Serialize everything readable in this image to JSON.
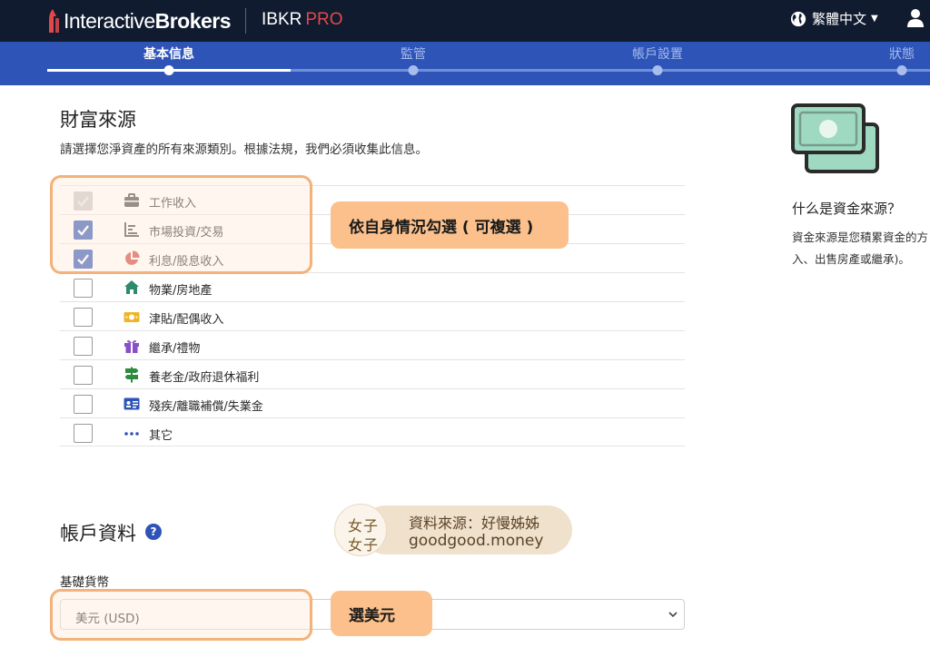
{
  "header": {
    "brand_prefix": "Interactive",
    "brand_suffix": "Brokers",
    "product": "IBKR",
    "product_tier": "PRO",
    "language": "繁體中文",
    "icons": [
      "ib-logo-icon",
      "globe-icon",
      "caret-down-icon",
      "user-icon"
    ]
  },
  "steps": [
    {
      "label": "基本信息",
      "active": true
    },
    {
      "label": "監管",
      "active": false
    },
    {
      "label": "帳戶設置",
      "active": false
    },
    {
      "label": "狀態",
      "active": false
    }
  ],
  "wealth": {
    "title": "財富來源",
    "description": "請選擇您淨資產的所有來源類別。根據法規，我們必須收集此信息。",
    "items": [
      {
        "label": "工作收入",
        "state": "disabled",
        "icon": "briefcase-icon",
        "color": "#444444"
      },
      {
        "label": "市場投資/交易",
        "state": "checked",
        "icon": "bar-chart-icon",
        "color": "#444444"
      },
      {
        "label": "利息/股息收入",
        "state": "checked",
        "icon": "pie-chart-icon",
        "color": "#d2403a"
      },
      {
        "label": "物業/房地產",
        "state": "unchecked",
        "icon": "house-icon",
        "color": "#2e8a6e"
      },
      {
        "label": "津貼/配偶收入",
        "state": "unchecked",
        "icon": "cash-icon",
        "color": "#f0b429"
      },
      {
        "label": "繼承/禮物",
        "state": "unchecked",
        "icon": "gift-icon",
        "color": "#8a4fc6"
      },
      {
        "label": "養老金/政府退休福利",
        "state": "unchecked",
        "icon": "signpost-icon",
        "color": "#2e8a3e"
      },
      {
        "label": "殘疾/離職補償/失業金",
        "state": "unchecked",
        "icon": "id-card-icon",
        "color": "#2e54b8"
      },
      {
        "label": "其它",
        "state": "unchecked",
        "icon": "more-dots-icon",
        "color": "#2e54b8"
      }
    ]
  },
  "annotations": {
    "select_hint": "依自身情況勾選 ( 可複選 )",
    "currency_hint": "選美元"
  },
  "account": {
    "title": "帳戶資料",
    "help": "?",
    "currency_label": "基礎貨幣",
    "currency_value": "美元 (USD)"
  },
  "watermark": {
    "logo_line1": "女子",
    "logo_line2": "女子",
    "line1": "資料來源：好慢姊姊",
    "line2": "goodgood.money"
  },
  "side": {
    "title": "什么是資金來源？",
    "desc_line1": "資金來源是您積累資金的方",
    "desc_line2": "入、出售房產或繼承)。"
  },
  "colors": {
    "topbar": "#101b2f",
    "accent": "#2e54b8",
    "brand_red": "#e24848",
    "highlight_border": "#f2b27a",
    "callout_bg": "#fbc08c"
  }
}
